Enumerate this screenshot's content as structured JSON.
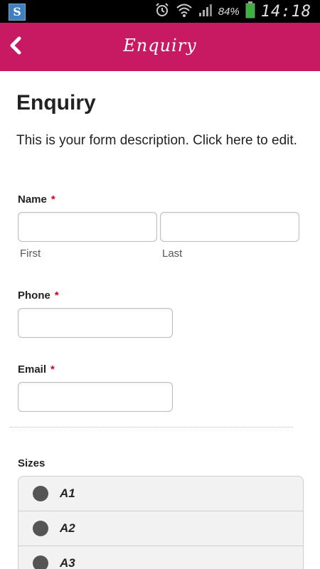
{
  "status_bar": {
    "app_icon_letter": "S",
    "battery_percent": "84%",
    "time": "14:18",
    "icons": [
      "alarm-icon",
      "wifi-icon",
      "signal-icon",
      "battery-icon"
    ]
  },
  "app_bar": {
    "title": "Enquiry",
    "back_icon": "chevron-left-icon",
    "color": "#c71a62"
  },
  "form": {
    "title": "Enquiry",
    "description": "This is your form description. Click here to edit.",
    "fields": {
      "name": {
        "label": "Name",
        "required_mark": "*",
        "first_sublabel": "First",
        "last_sublabel": "Last",
        "first_value": "",
        "last_value": ""
      },
      "phone": {
        "label": "Phone",
        "required_mark": "*",
        "value": ""
      },
      "email": {
        "label": "Email",
        "required_mark": "*",
        "value": ""
      }
    },
    "sizes": {
      "label": "Sizes",
      "options": [
        "A1",
        "A2",
        "A3"
      ]
    }
  }
}
